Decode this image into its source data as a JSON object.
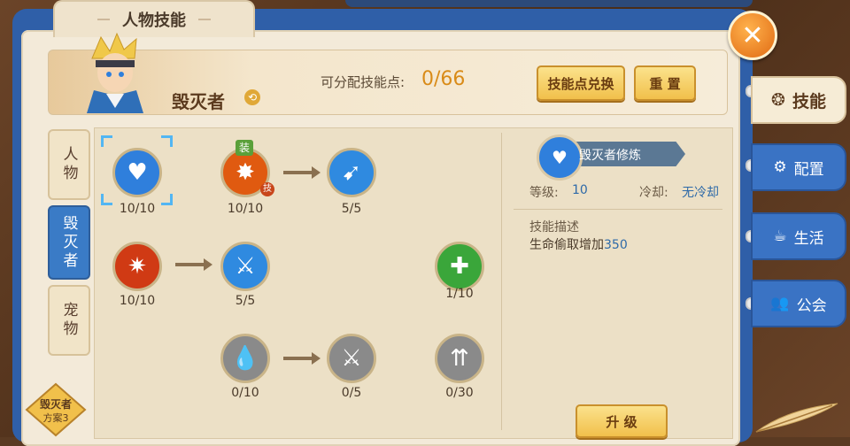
{
  "window": {
    "title": "人物技能",
    "close_symbol": "✕"
  },
  "hero": {
    "name": "毁灭者",
    "swap_icon": "⟲"
  },
  "points": {
    "label": "可分配技能点:",
    "value": "0/66"
  },
  "buttons": {
    "exchange": "技能点兑换",
    "reset": "重 置",
    "upgrade": "升 级"
  },
  "side_tabs": [
    {
      "label": "人物",
      "active": false
    },
    {
      "label": "毁灭者",
      "active": true
    },
    {
      "label": "宠物",
      "active": false
    }
  ],
  "plan": {
    "line1": "毁灭者",
    "line2": "方案3"
  },
  "skills": [
    {
      "id": "s1",
      "level": "10/10",
      "glyph": "♥",
      "color": "#2f7fdc"
    },
    {
      "id": "s2",
      "level": "10/10",
      "glyph": "✸",
      "color": "#e05a10",
      "badge_top": "装",
      "badge_side": "技"
    },
    {
      "id": "s3",
      "level": "5/5",
      "glyph": "➹",
      "color": "#2f8ae0"
    },
    {
      "id": "s4",
      "level": "10/10",
      "glyph": "✷",
      "color": "#d03a14"
    },
    {
      "id": "s5",
      "level": "5/5",
      "glyph": "⚔",
      "color": "#2f8ae0"
    },
    {
      "id": "s6",
      "level": "1/10",
      "glyph": "✚",
      "color": "#3aa63a"
    },
    {
      "id": "s7",
      "level": "0/10",
      "glyph": "💧",
      "color": "#8a8a8a"
    },
    {
      "id": "s8",
      "level": "0/5",
      "glyph": "⚔",
      "color": "#8a8a8a"
    },
    {
      "id": "s9",
      "level": "0/30",
      "glyph": "⇈",
      "color": "#8a8a8a"
    }
  ],
  "detail": {
    "name": "毁灭者修炼",
    "level_label": "等级:",
    "level_value": "10",
    "cooldown_label": "冷却:",
    "cooldown_value": "无冷却",
    "desc_title": "技能描述",
    "desc_text": "生命偷取增加",
    "desc_value": "350"
  },
  "right_tabs": [
    {
      "label": "技能",
      "icon": "❂",
      "active": true
    },
    {
      "label": "配置",
      "icon": "⚙",
      "active": false
    },
    {
      "label": "生活",
      "icon": "☕",
      "active": false
    },
    {
      "label": "公会",
      "icon": "👥",
      "active": false
    }
  ]
}
